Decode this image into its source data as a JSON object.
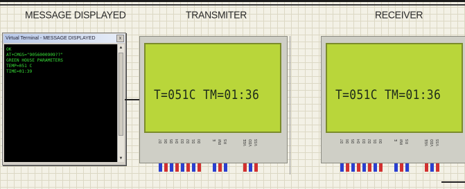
{
  "labels": {
    "message": "MESSAGE DISPLAYED",
    "transmitter": "TRANSMITER",
    "receiver": "RECEIVER"
  },
  "terminal": {
    "title": "Virtual Terminal - MESSAGE DISPLAYED",
    "close": "x",
    "lines": [
      "OK",
      "AT+CMGS=\"9056000909??\"",
      "GREEN HOUSE PARAMETERS",
      "TEMP=051 C",
      "TIME=01:39"
    ]
  },
  "transmitter_lcd": {
    "text": "T=051C TM=01:36"
  },
  "receiver_lcd": {
    "text": "T=051C TM=01:36"
  },
  "lcd_pins": [
    "D7",
    "D6",
    "D5",
    "D4",
    "D3",
    "D2",
    "D1",
    "D0",
    "E",
    "RW",
    "RS",
    "VEE",
    "VDD",
    "VSS"
  ]
}
